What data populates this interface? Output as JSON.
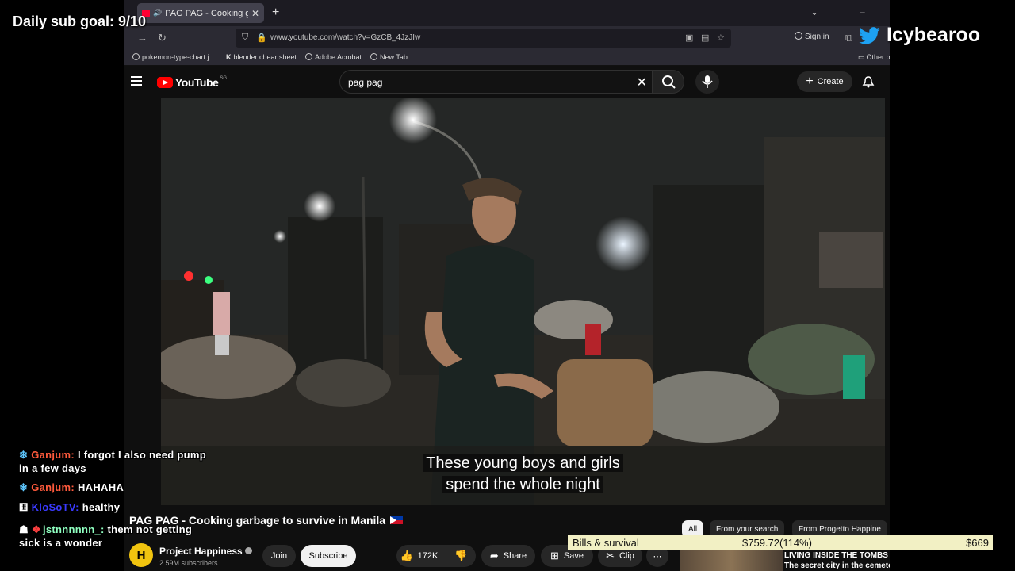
{
  "browser": {
    "tab_title": "PAG PAG - Cooking garbage",
    "url": "www.youtube.com/watch?v=GzCB_4JzJIw",
    "signin_label": "Sign in",
    "bookmarks": [
      "pokemon-type-chart.j...",
      "blender chear sheet",
      "Adobe Acrobat",
      "New Tab"
    ],
    "other_bookmarks": "Other b"
  },
  "youtube": {
    "logo": "YouTube",
    "country_code": "SG",
    "search_query": "pag pag",
    "create_label": "Create",
    "caption_lines": [
      "These young boys and girls",
      "spend the whole night"
    ],
    "video_title": "PAG PAG - Cooking garbage to survive in Manila",
    "channel_initial": "H",
    "channel_name": "Project Happiness",
    "subscriber_count": "2.59M subscribers",
    "join_label": "Join",
    "subscribe_label": "Subscribe",
    "like_count": "172K",
    "share_label": "Share",
    "save_label": "Save",
    "clip_label": "Clip",
    "chips": [
      "All",
      "From your search",
      "From Progetto Happine"
    ],
    "rec_title_lines": [
      "LIVING INSIDE THE TOMBS -",
      "The secret city in the cemete"
    ]
  },
  "stream": {
    "sub_goal": "Daily sub goal: 9/10",
    "twitter_handle": "Icybearoo",
    "chat": [
      {
        "user": "Ganjum:",
        "message": "I forgot I also need pump",
        "cont": "in a few days"
      },
      {
        "user": "Ganjum:",
        "message": "HAHAHA"
      },
      {
        "user": "KloSoTV:",
        "message": "healthy"
      },
      {
        "user": "jstnnnnnn_:",
        "message": "them not getting",
        "cont": "sick is a wonder"
      }
    ],
    "bills": {
      "label": "Bills & survival",
      "current": "$759.72(114%)",
      "goal": "$669"
    }
  },
  "colors": {
    "youtube_red": "#ff0000",
    "twitter_blue": "#1da1f2",
    "bills_bg": "#f2f0c4"
  }
}
